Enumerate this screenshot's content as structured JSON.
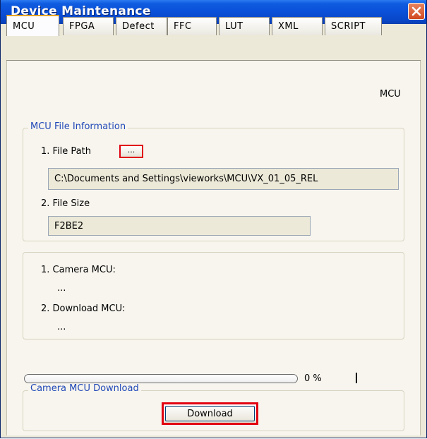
{
  "window": {
    "title": "Device Maintenance",
    "close_icon": "close-icon"
  },
  "tabs": [
    {
      "label": "MCU",
      "active": true
    },
    {
      "label": "FPGA",
      "active": false
    },
    {
      "label": "Defect",
      "active": false
    },
    {
      "label": "FFC",
      "active": false
    },
    {
      "label": "LUT",
      "active": false
    },
    {
      "label": "XML",
      "active": false
    },
    {
      "label": "SCRIPT",
      "active": false
    }
  ],
  "panel": {
    "heading": "MCU",
    "file_info": {
      "legend": "MCU File Information",
      "file_path_label": "1. File Path",
      "browse_label": "...",
      "file_path_value": "C:\\Documents and Settings\\vieworks\\MCU\\VX_01_05_REL",
      "file_size_label": "2. File Size",
      "file_size_value": "F2BE2"
    },
    "versions": {
      "camera_mcu_label": "1. Camera MCU:",
      "camera_mcu_value": "...",
      "download_mcu_label": "2. Download MCU:",
      "download_mcu_value": "..."
    },
    "progress": {
      "value": 0,
      "text": "0 %",
      "separator": "|"
    },
    "download_group": {
      "legend": "Camera MCU Download",
      "button_label": "Download"
    }
  },
  "colors": {
    "title_bar": "#0A50D8",
    "accent_legend": "#2148B8",
    "highlight_border": "#E10010",
    "active_tab_top": "#E8A424"
  }
}
